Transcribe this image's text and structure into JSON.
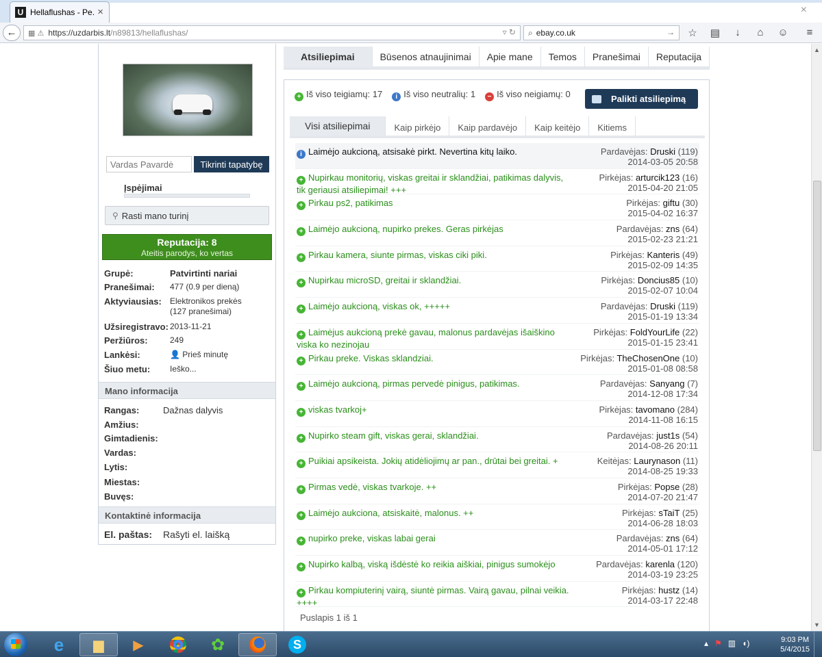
{
  "browser": {
    "tab_title": "Hellaflushas - Pe...",
    "tab_favicon": "U",
    "url_host": "https://uzdarbis.lt",
    "url_path": "/n89813/hellaflushas/",
    "search_value": "ebay.co.uk"
  },
  "sidebar": {
    "name_placeholder": "Vardas Pavardė",
    "verify_label": "Tikrinti tapatybę",
    "warnings_label": "Įspėjimai",
    "find_content_label": "Rasti mano turinį",
    "reputation_title": "Reputacija: 8",
    "reputation_subtitle": "Ateitis parodys, ko vertas",
    "profile": [
      {
        "k": "Grupė:",
        "v": "Patvirtinti nariai"
      },
      {
        "k": "Pranešimai:",
        "v": "477 (0.9 per dieną)"
      },
      {
        "k": "Aktyviausias:",
        "v": "Elektronikos prekės",
        "v2": "(127 pranešimai)"
      },
      {
        "k": "Užsiregistravo:",
        "v": "2013-11-21"
      },
      {
        "k": "Peržiūros:",
        "v": "249"
      },
      {
        "k": "Lankėsi:",
        "v": "Prieš minutę"
      },
      {
        "k": "Šiuo metu:",
        "v": "Ieško..."
      }
    ],
    "my_info_title": "Mano informacija",
    "my_info": [
      {
        "k": "Rangas:",
        "v": "Dažnas dalyvis"
      },
      {
        "k": "Amžius:",
        "v": ""
      },
      {
        "k": "Gimtadienis:",
        "v": ""
      },
      {
        "k": "Vardas:",
        "v": ""
      },
      {
        "k": "Lytis:",
        "v": ""
      },
      {
        "k": "Miestas:",
        "v": ""
      },
      {
        "k": "Buvęs:",
        "v": ""
      }
    ],
    "contact_title": "Kontaktinė informacija",
    "email_label": "El. paštas:",
    "email_value": "Rašyti el. laišką"
  },
  "main_tabs": [
    "Atsiliepimai",
    "Būsenos atnaujinimai",
    "Apie mane",
    "Temos",
    "Pranešimai",
    "Reputacija"
  ],
  "summary": {
    "positive": "Iš viso teigiamų: 17",
    "neutral": "Iš viso neutralių: 1",
    "negative": "Iš viso neigiamų: 0"
  },
  "leave_feedback_label": "Palikti atsiliepimą",
  "sub_tabs": [
    "Visi atsiliepimai",
    "Kaip pirkėjo",
    "Kaip pardavėjo",
    "Kaip keitėjo",
    "Kitiems"
  ],
  "feedback": [
    {
      "type": "neutral",
      "text": "Laimėjo aukcioną, atsisakė pirkt. Nevertina kitų laiko.",
      "role": "Pardavėjas:",
      "user": "Druski",
      "count": "(119)",
      "date": "2014-03-05 20:58"
    },
    {
      "type": "positive",
      "text": "Nupirkau monitorių, viskas greitai ir sklandžiai, patikimas dalyvis, tik geriausi atsiliepimai! +++",
      "role": "Pirkėjas:",
      "user": "arturcik123",
      "count": "(16)",
      "date": "2015-04-20 21:05"
    },
    {
      "type": "positive",
      "text": "Pirkau ps2, patikimas",
      "role": "Pirkėjas:",
      "user": "giftu",
      "count": "(30)",
      "date": "2015-04-02 16:37"
    },
    {
      "type": "positive",
      "text": "Laimėjo aukcioną, nupirko prekes. Geras pirkėjas",
      "role": "Pardavėjas:",
      "user": "zns",
      "count": "(64)",
      "date": "2015-02-23 21:21"
    },
    {
      "type": "positive",
      "text": "Pirkau kamera, siunte pirmas, viskas ciki piki.",
      "role": "Pirkėjas:",
      "user": "Kanteris",
      "count": "(49)",
      "date": "2015-02-09 14:35"
    },
    {
      "type": "positive",
      "text": "Nupirkau microSD, greitai ir sklandžiai.",
      "role": "Pirkėjas:",
      "user": "Doncius85",
      "count": "(10)",
      "date": "2015-02-07 10:04"
    },
    {
      "type": "positive",
      "text": "Laimėjo aukcioną, viskas ok, +++++",
      "role": "Pardavėjas:",
      "user": "Druski",
      "count": "(119)",
      "date": "2015-01-19 13:34"
    },
    {
      "type": "positive",
      "text": "Laimėjus aukcioną prekė gavau, malonus pardavėjas išaiškino viska ko nezinojau",
      "role": "Pirkėjas:",
      "user": "FoldYourLife",
      "count": "(22)",
      "date": "2015-01-15 23:41"
    },
    {
      "type": "positive",
      "text": "Pirkau preke. Viskas sklandziai.",
      "role": "Pirkėjas:",
      "user": "TheChosenOne",
      "count": "(10)",
      "date": "2015-01-08 08:58"
    },
    {
      "type": "positive",
      "text": "Laimėjo aukcioną, pirmas pervedė pinigus, patikimas.",
      "role": "Pardavėjas:",
      "user": "Sanyang",
      "count": "(7)",
      "date": "2014-12-08 17:34"
    },
    {
      "type": "positive",
      "text": "viskas tvarkoj+",
      "role": "Pirkėjas:",
      "user": "tavomano",
      "count": "(284)",
      "date": "2014-11-08 16:15"
    },
    {
      "type": "positive",
      "text": "Nupirko steam gift, viskas gerai, sklandžiai.",
      "role": "Pardavėjas:",
      "user": "just1s",
      "count": "(54)",
      "date": "2014-08-26 20:11"
    },
    {
      "type": "positive",
      "text": "Puikiai apsikeista. Jokių atidėliojimų ar pan., drūtai bei greitai. +",
      "role": "Keitėjas:",
      "user": "Laurynason",
      "count": "(11)",
      "date": "2014-08-25 19:33"
    },
    {
      "type": "positive",
      "text": "Pirmas vedė, viskas tvarkoje. ++",
      "role": "Pirkėjas:",
      "user": "Popse",
      "count": "(28)",
      "date": "2014-07-20 21:47"
    },
    {
      "type": "positive",
      "text": "Laimėjo aukciona, atsiskaitė, malonus. ++",
      "role": "Pirkėjas:",
      "user": "sTaiT",
      "count": "(25)",
      "date": "2014-06-28 18:03"
    },
    {
      "type": "positive",
      "text": "nupirko preke, viskas labai gerai",
      "role": "Pardavėjas:",
      "user": "zns",
      "count": "(64)",
      "date": "2014-05-01 17:12"
    },
    {
      "type": "positive",
      "text": "Nupirko kalbą, viską išdėstė ko reikia aiškiai, pinigus sumokėjo",
      "role": "Pardavėjas:",
      "user": "karenla",
      "count": "(120)",
      "date": "2014-03-19 23:25"
    },
    {
      "type": "positive",
      "text": "Pirkau kompiuterinį vairą, siuntė pirmas. Vairą gavau, pilnai veikia. ++++",
      "role": "Pirkėjas:",
      "user": "hustz",
      "count": "(14)",
      "date": "2014-03-17 22:48"
    }
  ],
  "pager": "Puslapis 1 iš 1",
  "taskbar": {
    "time": "9:03 PM",
    "date": "5/4/2015"
  },
  "colors": {
    "accent_dark": "#1f3a57",
    "positive": "#47b535",
    "reputation": "#3e8e1e"
  }
}
